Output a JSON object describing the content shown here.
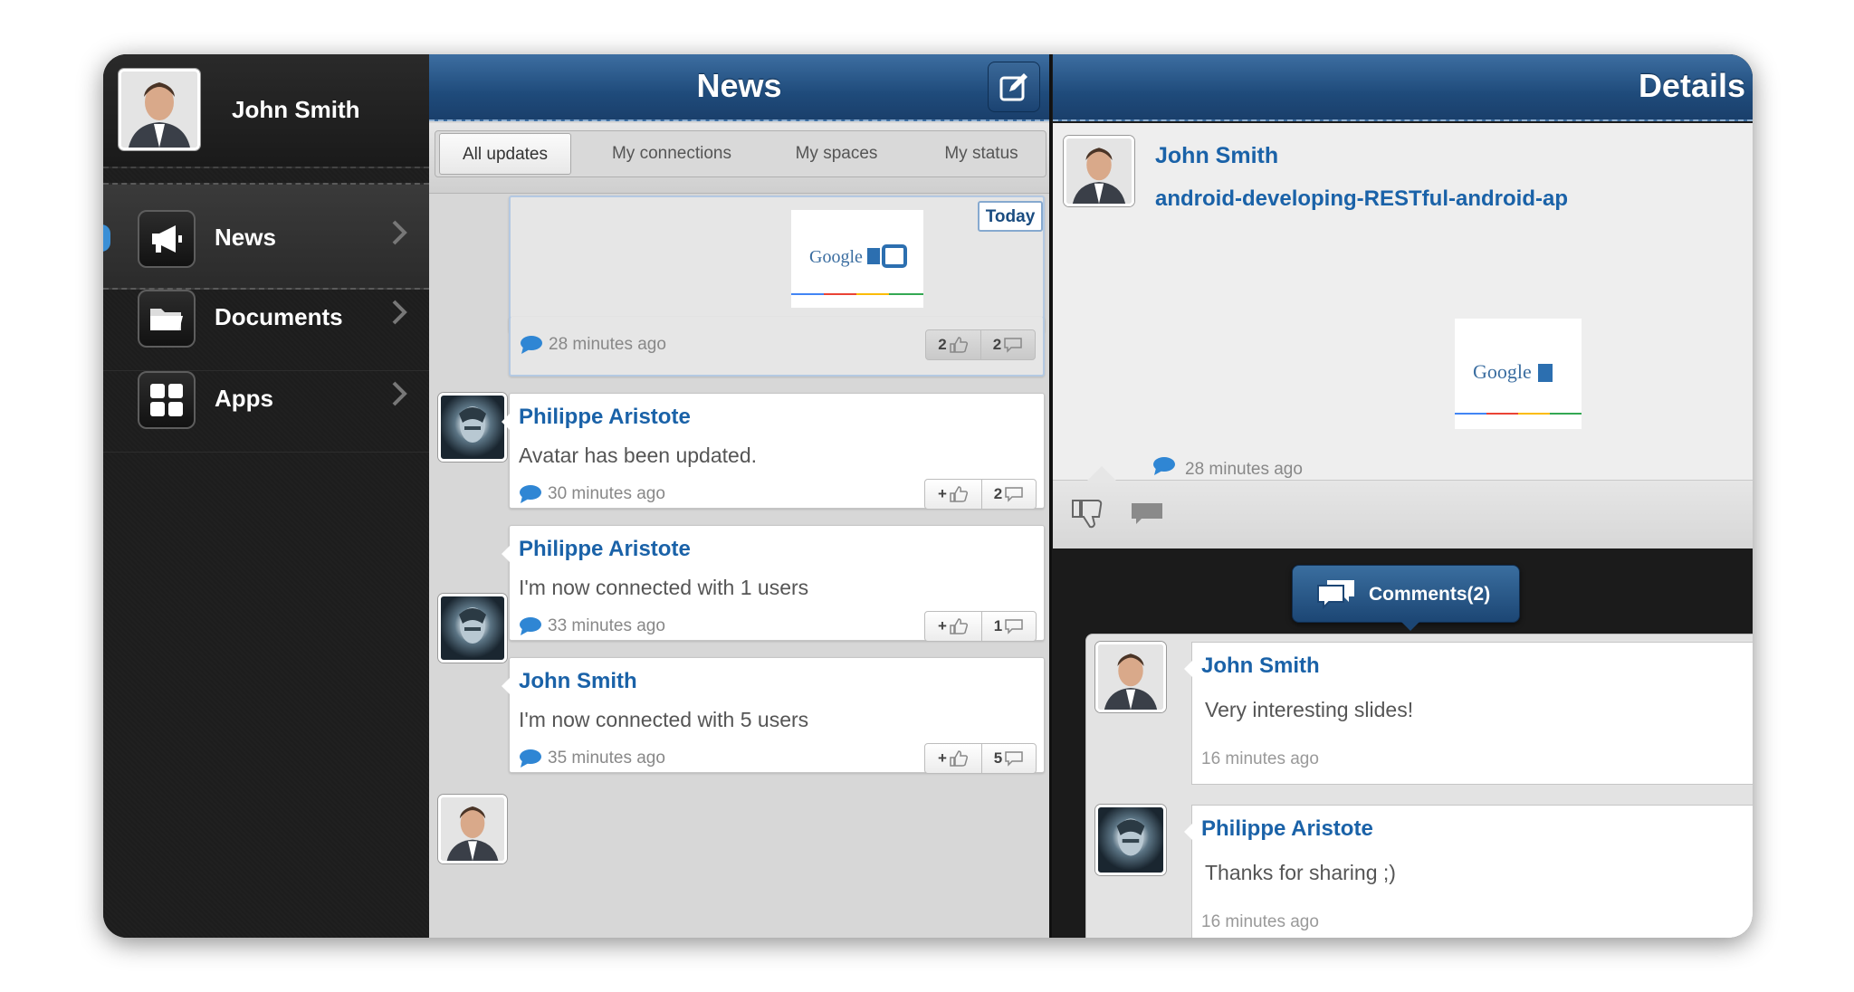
{
  "sidebar": {
    "user_name": "John Smith",
    "items": [
      {
        "label": "News",
        "icon": "megaphone-icon"
      },
      {
        "label": "Documents",
        "icon": "folder-icon"
      },
      {
        "label": "Apps",
        "icon": "apps-grid-icon"
      }
    ]
  },
  "news": {
    "title": "News",
    "filters": [
      "All updates",
      "My connections",
      "My spaces",
      "My status"
    ],
    "selected_filter": "All updates",
    "today_label": "Today",
    "first_card": {
      "image": "Google I/O",
      "time": "28 minutes ago",
      "likes": "2",
      "comments": "2"
    },
    "activities": [
      {
        "author": "Philippe Aristote",
        "text": "Avatar has been updated.",
        "time": "30 minutes ago",
        "like_label": "+",
        "comments": "2"
      },
      {
        "author": "Philippe Aristote",
        "text": "I'm now connected with 1 users",
        "time": "33 minutes ago",
        "like_label": "+",
        "comments": "1"
      },
      {
        "author": "John Smith",
        "text": "I'm now connected with 5 users",
        "time": "35 minutes ago",
        "like_label": "+",
        "comments": "5"
      }
    ]
  },
  "details": {
    "title": "Details",
    "author": "John Smith",
    "post_title": "android-developing-RESTful-android-ap",
    "image": "Google I/O",
    "time": "28 minutes ago",
    "comments_button": "Comments(2)",
    "comments": [
      {
        "author": "John Smith",
        "text": "Very interesting slides!",
        "time": "16 minutes ago"
      },
      {
        "author": "Philippe Aristote",
        "text": "Thanks for sharing ;)",
        "time": "16 minutes ago"
      }
    ]
  },
  "colors": {
    "brand_blue": "#1f4b7b",
    "link_blue": "#1a62a8",
    "sidebar_bg": "#1d1d1d"
  }
}
